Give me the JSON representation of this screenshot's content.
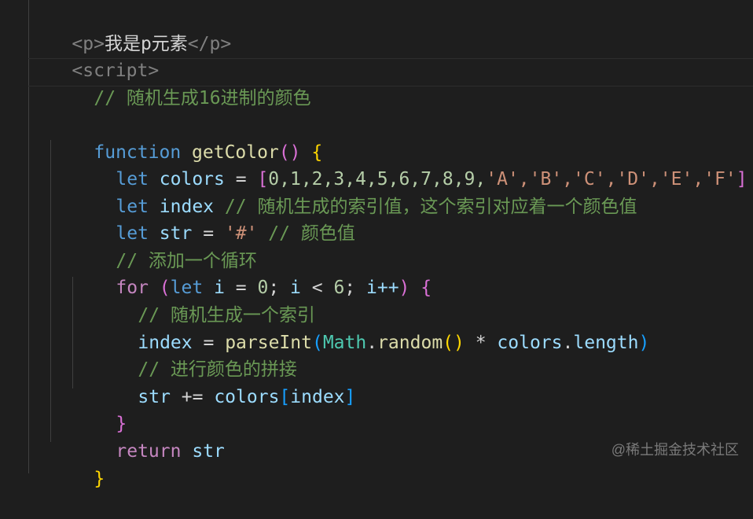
{
  "code": {
    "l1_open": "<p>",
    "l1_text": "我是p元素",
    "l1_close": "</p>",
    "l2": "<script>",
    "l3": "// 随机生成16进制的颜色",
    "l5_kw": "function",
    "l5_fn": "getColor",
    "l5_rest": "()",
    "l5_brace": "{",
    "l6_kw": "let",
    "l6_var": "colors",
    "l6_eq": " = ",
    "l6_open": "[",
    "l6_nums": "0,1,2,3,4,5,6,7,8,9,",
    "l6_strs": "'A','B','C','D','E','F'",
    "l6_close": "]",
    "l7_kw": "let",
    "l7_var": "index",
    "l7_cmt": "// 随机生成的索引值，这个索引对应着一个颜色值",
    "l8_kw": "let",
    "l8_var": "str",
    "l8_eq": " = ",
    "l8_str": "'#'",
    "l8_cmt": "// 颜色值",
    "l9_cmt": "// 添加一个循环",
    "l10_for": "for",
    "l10_open": "(",
    "l10_let": "let",
    "l10_i": "i",
    "l10_eq": " = ",
    "l10_zero": "0",
    "l10_semi": "; ",
    "l10_i2": "i",
    "l10_lt": " < ",
    "l10_six": "6",
    "l10_semi2": "; ",
    "l10_inc": "i++",
    "l10_close": ")",
    "l10_brace": "{",
    "l11_cmt": "// 随机生成一个索引",
    "l12_var": "index",
    "l12_eq": " = ",
    "l12_fn": "parseInt",
    "l12_open": "(",
    "l12_cls": "Math",
    "l12_dot": ".",
    "l12_fn2": "random",
    "l12_par": "()",
    "l12_mul": " * ",
    "l12_var2": "colors",
    "l12_dot2": ".",
    "l12_len": "length",
    "l12_close": ")",
    "l13_cmt": "// 进行颜色的拼接",
    "l14_var": "str",
    "l14_op": " += ",
    "l14_var2": "colors",
    "l14_open": "[",
    "l14_idx": "index",
    "l14_close": "]",
    "l15_brace": "}",
    "l16_kw": "return",
    "l16_var": "str",
    "l17_brace": "}"
  },
  "watermark": "@稀土掘金技术社区",
  "colors": {
    "background": "#1e1e1e",
    "keyword": "#569cd6",
    "control": "#c586c0",
    "function": "#dcdcaa",
    "variable": "#9cdcfe",
    "number": "#b5cea8",
    "string": "#ce9178",
    "comment": "#6a9955"
  }
}
